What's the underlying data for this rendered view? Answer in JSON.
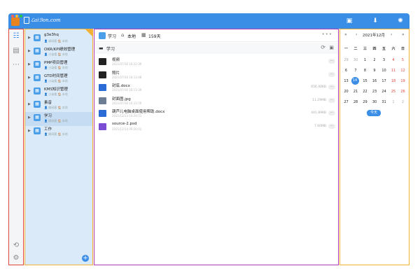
{
  "window": {
    "traffic_colors": [
      "#ff5f57",
      "#febc2e",
      "#28c840"
    ],
    "brand_color": "#3a8ee6",
    "logo_text": "ℒaiℬon.com"
  },
  "topbar_icons": [
    "message-icon",
    "download-icon",
    "settings-icon"
  ],
  "rail": {
    "items": [
      {
        "icon": "workspace-icon"
      },
      {
        "icon": "document-icon"
      },
      {
        "icon": "more-icon"
      }
    ],
    "bottom_items": [
      {
        "icon": "sync-icon"
      },
      {
        "icon": "settings-gear-icon"
      }
    ]
  },
  "tree": {
    "items": [
      {
        "name": "g3e3hq",
        "meta": "👤 柳闲客  🏠 本地",
        "active": false
      },
      {
        "name": "OKR/KPI绩效管理",
        "meta": "👤 小柒楼  🏠 本地",
        "active": false
      },
      {
        "name": "PMP项目管理",
        "meta": "👤 小柒楼  🏠 本地",
        "active": false
      },
      {
        "name": "GTD时间管理",
        "meta": "👤 小柒楼  🏠 本地",
        "active": false
      },
      {
        "name": "KMS知识管理",
        "meta": "👤 小柒楼  🏠 本地",
        "active": false
      },
      {
        "name": "素音",
        "meta": "👤 柳闲客  🏠 本地",
        "active": false
      },
      {
        "name": "学习",
        "meta": "👤 柳闲客  🏠 本地",
        "active": true
      },
      {
        "name": "工作",
        "meta": "👤 柳闲客  🏠 本地",
        "active": false
      }
    ],
    "add_label": "+"
  },
  "main": {
    "title": "学习",
    "location": "本地",
    "days": "159天",
    "more": "•••",
    "crumb": "学习",
    "files": [
      {
        "name": "视频",
        "date": "2021/07/30 16:22:30",
        "size": "",
        "icon": "folder-video-icon",
        "color": "#222222"
      },
      {
        "name": "照片",
        "date": "2021/07/30 16:13:48",
        "size": "",
        "icon": "folder-photo-icon",
        "color": "#222222"
      },
      {
        "name": "封底.docx",
        "date": "2021/07/30 16:13:39",
        "size": "656.40KB",
        "icon": "word-icon",
        "color": "#2b6bd6"
      },
      {
        "name": "封面图.jpg",
        "date": "2021/07/30 16:33:50",
        "size": "11.29MB",
        "icon": "image-icon",
        "color": "#6b7c93"
      },
      {
        "name": "葫芦儿电脑桌面使用帮助.docx",
        "date": "2021/12/13 10:28:51",
        "size": "441.89KB",
        "icon": "word-icon",
        "color": "#2b6bd6"
      },
      {
        "name": "source-2.psd",
        "date": "2021/12/14 09:26:02",
        "size": "7.60MB",
        "icon": "psd-icon",
        "color": "#7b4cd6"
      }
    ]
  },
  "calendar": {
    "month_label": "2021年12月",
    "prev_year": "«",
    "prev_month": "‹",
    "next_month": "›",
    "next_year": "»",
    "weekdays": [
      "一",
      "二",
      "三",
      "四",
      "五",
      "六",
      "日"
    ],
    "weeks": [
      [
        "29",
        "30",
        "1",
        "2",
        "3",
        "4",
        "5"
      ],
      [
        "6",
        "7",
        "8",
        "9",
        "10",
        "11",
        "12"
      ],
      [
        "13",
        "14",
        "15",
        "16",
        "17",
        "18",
        "19"
      ],
      [
        "20",
        "21",
        "22",
        "23",
        "24",
        "25",
        "26"
      ],
      [
        "27",
        "28",
        "29",
        "30",
        "31",
        "1",
        "2"
      ]
    ],
    "today": "14",
    "today_button": "今天"
  }
}
